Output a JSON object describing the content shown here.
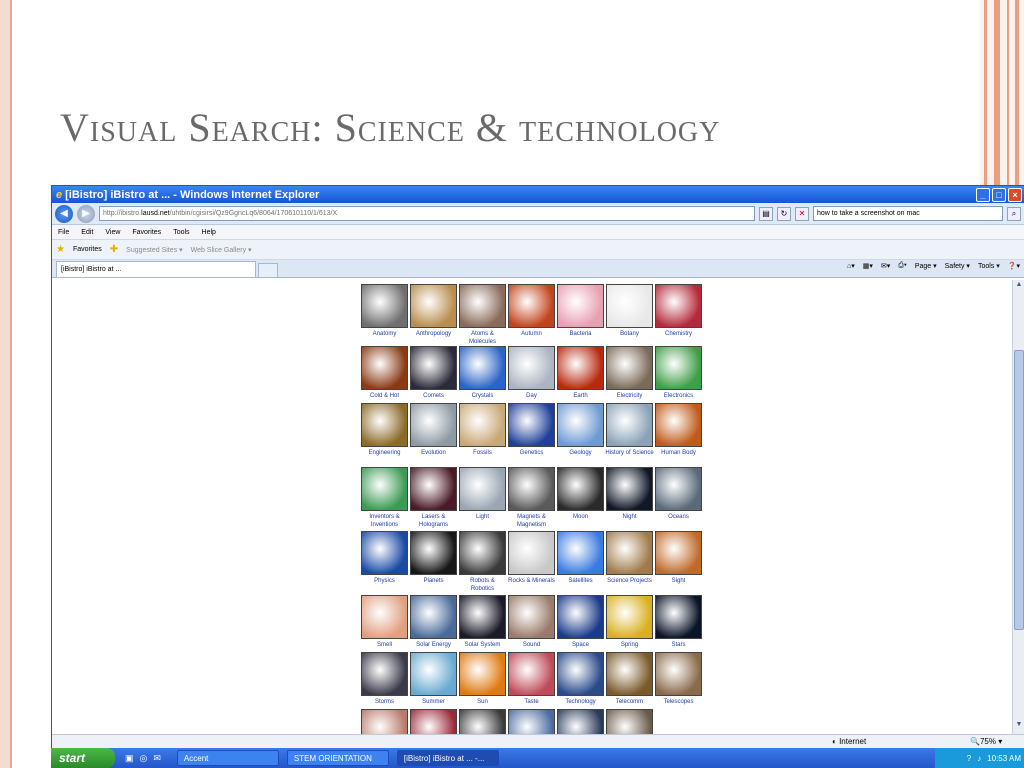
{
  "slide": {
    "title": "Visual Search: Science & technology"
  },
  "window": {
    "title": "[iBistro] iBistro at ... - Windows Internet Explorer",
    "minimize": "_",
    "maximize": "□",
    "close": "×"
  },
  "address_bar": {
    "url_prefix": "http://ibistro.",
    "url_domain": "lausd.net",
    "url_path": "/uhtbin/cgisirsi/Qz9GgncLq6/8064/170610110/1/613/X",
    "search_value": "how to take a screenshot on mac"
  },
  "menu": [
    "File",
    "Edit",
    "View",
    "Favorites",
    "Tools",
    "Help"
  ],
  "favorites_bar": {
    "favorites": "Favorites",
    "suggested_sites": "Suggested Sites ▾",
    "web_slice_gallery": "Web Slice Gallery ▾"
  },
  "tab": {
    "label": "[iBistro] iBistro at ..."
  },
  "command_bar": {
    "page": "Page ▾",
    "safety": "Safety ▾",
    "tools": "Tools ▾",
    "help": "❓▾"
  },
  "categories": [
    {
      "label": "Anatomy",
      "color": "#6f6f6f"
    },
    {
      "label": "Anthropology",
      "color": "#b88d4e"
    },
    {
      "label": "Atoms & Molecules",
      "color": "#8a6a5a"
    },
    {
      "label": "Autumn",
      "color": "#c2441c"
    },
    {
      "label": "Bacteria",
      "color": "#e7a0b2"
    },
    {
      "label": "Botany",
      "color": "#e8e8e8"
    },
    {
      "label": "Chemistry",
      "color": "#b52a3a"
    },
    {
      "label": "Cold & Hot",
      "color": "#8a3a14"
    },
    {
      "label": "Comets",
      "color": "#2a2a3a"
    },
    {
      "label": "Crystals",
      "color": "#2b63c6"
    },
    {
      "label": "Day",
      "color": "#aab4c2"
    },
    {
      "label": "Earth",
      "color": "#b82a10"
    },
    {
      "label": "Electricity",
      "color": "#7a6a58"
    },
    {
      "label": "Electronics",
      "color": "#3f9e48"
    },
    {
      "label": "Engineering",
      "color": "#8c6a2a"
    },
    {
      "label": "Evolution",
      "color": "#8d9aa4"
    },
    {
      "label": "Fossils",
      "color": "#c9a877"
    },
    {
      "label": "Genetics",
      "color": "#1f3f9a"
    },
    {
      "label": "Geology",
      "color": "#6e9ad2"
    },
    {
      "label": "History of Science",
      "color": "#8aa2b8"
    },
    {
      "label": "Human Body",
      "color": "#c05a1a"
    },
    {
      "label": "Inventors & Inventions",
      "color": "#3d9a54"
    },
    {
      "label": "Lasers & Holograms",
      "color": "#4a1a26"
    },
    {
      "label": "Light",
      "color": "#9aa6b4"
    },
    {
      "label": "Magnets & Magnetism",
      "color": "#5a5a5a"
    },
    {
      "label": "Moon",
      "color": "#2a2a2a"
    },
    {
      "label": "Night",
      "color": "#101828"
    },
    {
      "label": "Oceans",
      "color": "#5a6a7a"
    },
    {
      "label": "Physics",
      "color": "#1a4aa4"
    },
    {
      "label": "Planets",
      "color": "#181818"
    },
    {
      "label": "Robots & Robotics",
      "color": "#3a3a3a"
    },
    {
      "label": "Rocks & Minerals",
      "color": "#c8c8c8"
    },
    {
      "label": "Satellites",
      "color": "#3a7ae0"
    },
    {
      "label": "Science Projects",
      "color": "#a07a4a"
    },
    {
      "label": "Sight",
      "color": "#c06a2a"
    },
    {
      "label": "Smell",
      "color": "#e0a080"
    },
    {
      "label": "Solar Energy",
      "color": "#4a6a9a"
    },
    {
      "label": "Solar System",
      "color": "#1a1a2a"
    },
    {
      "label": "Sound",
      "color": "#9a7a6a"
    },
    {
      "label": "Space",
      "color": "#1a3a8a"
    },
    {
      "label": "Spring",
      "color": "#d8b020"
    },
    {
      "label": "Stars",
      "color": "#0a1428"
    },
    {
      "label": "Storms",
      "color": "#3a3a4a"
    },
    {
      "label": "Summer",
      "color": "#6aaad0"
    },
    {
      "label": "Sun",
      "color": "#e07a10"
    },
    {
      "label": "Taste",
      "color": "#c04a5a"
    },
    {
      "label": "Technology",
      "color": "#2a4a8a"
    },
    {
      "label": "Telecomm",
      "color": "#7a5a2a"
    },
    {
      "label": "Telescopes",
      "color": "#8a6a4a"
    },
    {
      "label": "",
      "color": "#b87a6a"
    },
    {
      "label": "",
      "color": "#9a2a3a"
    },
    {
      "label": "",
      "color": "#3a3a3a"
    },
    {
      "label": "",
      "color": "#4a6aa0"
    },
    {
      "label": "",
      "color": "#2a3a5a"
    },
    {
      "label": "",
      "color": "#6a5a4a"
    }
  ],
  "status_bar": {
    "zone": "Internet",
    "zoom": "75%"
  },
  "taskbar": {
    "start": "start",
    "items": [
      {
        "label": "Accent"
      },
      {
        "label": "STEM ORIENTATION"
      },
      {
        "label": "[iBistro] iBistro at ... -..."
      }
    ],
    "clock": "10:53 AM"
  }
}
